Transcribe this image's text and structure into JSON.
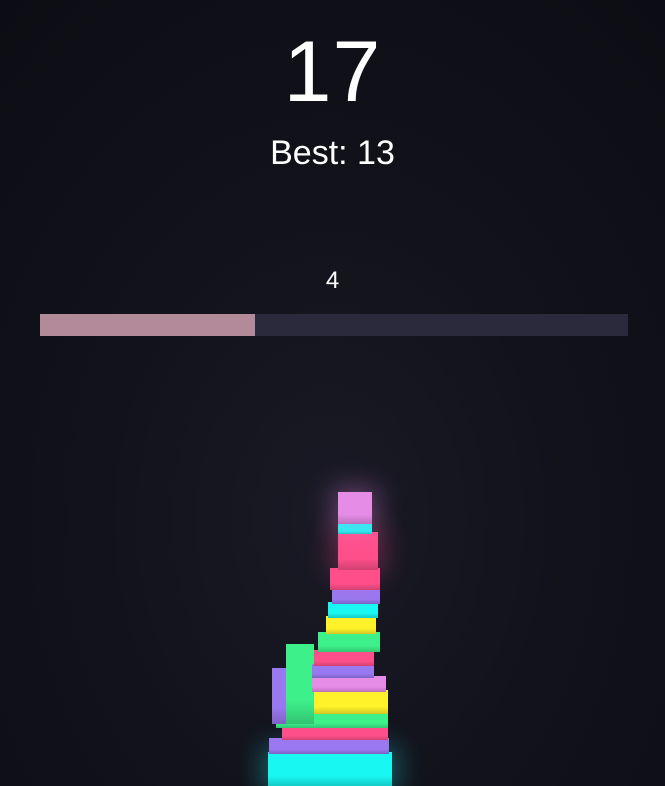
{
  "hud": {
    "score": "17",
    "best": "Best: 13",
    "progress_value": "4"
  },
  "progress": {
    "fraction": 0.365,
    "fill_color": "#b28a99",
    "track_color": "#2a2a3c"
  },
  "palette": {
    "cyan": "#19f7f2",
    "magenta": "#e58ce6",
    "pink": "#ff4f8a",
    "yellow": "#fff22a",
    "green": "#3ef08a",
    "violet": "#9a78f0"
  },
  "tower": {
    "block_count": 17
  }
}
